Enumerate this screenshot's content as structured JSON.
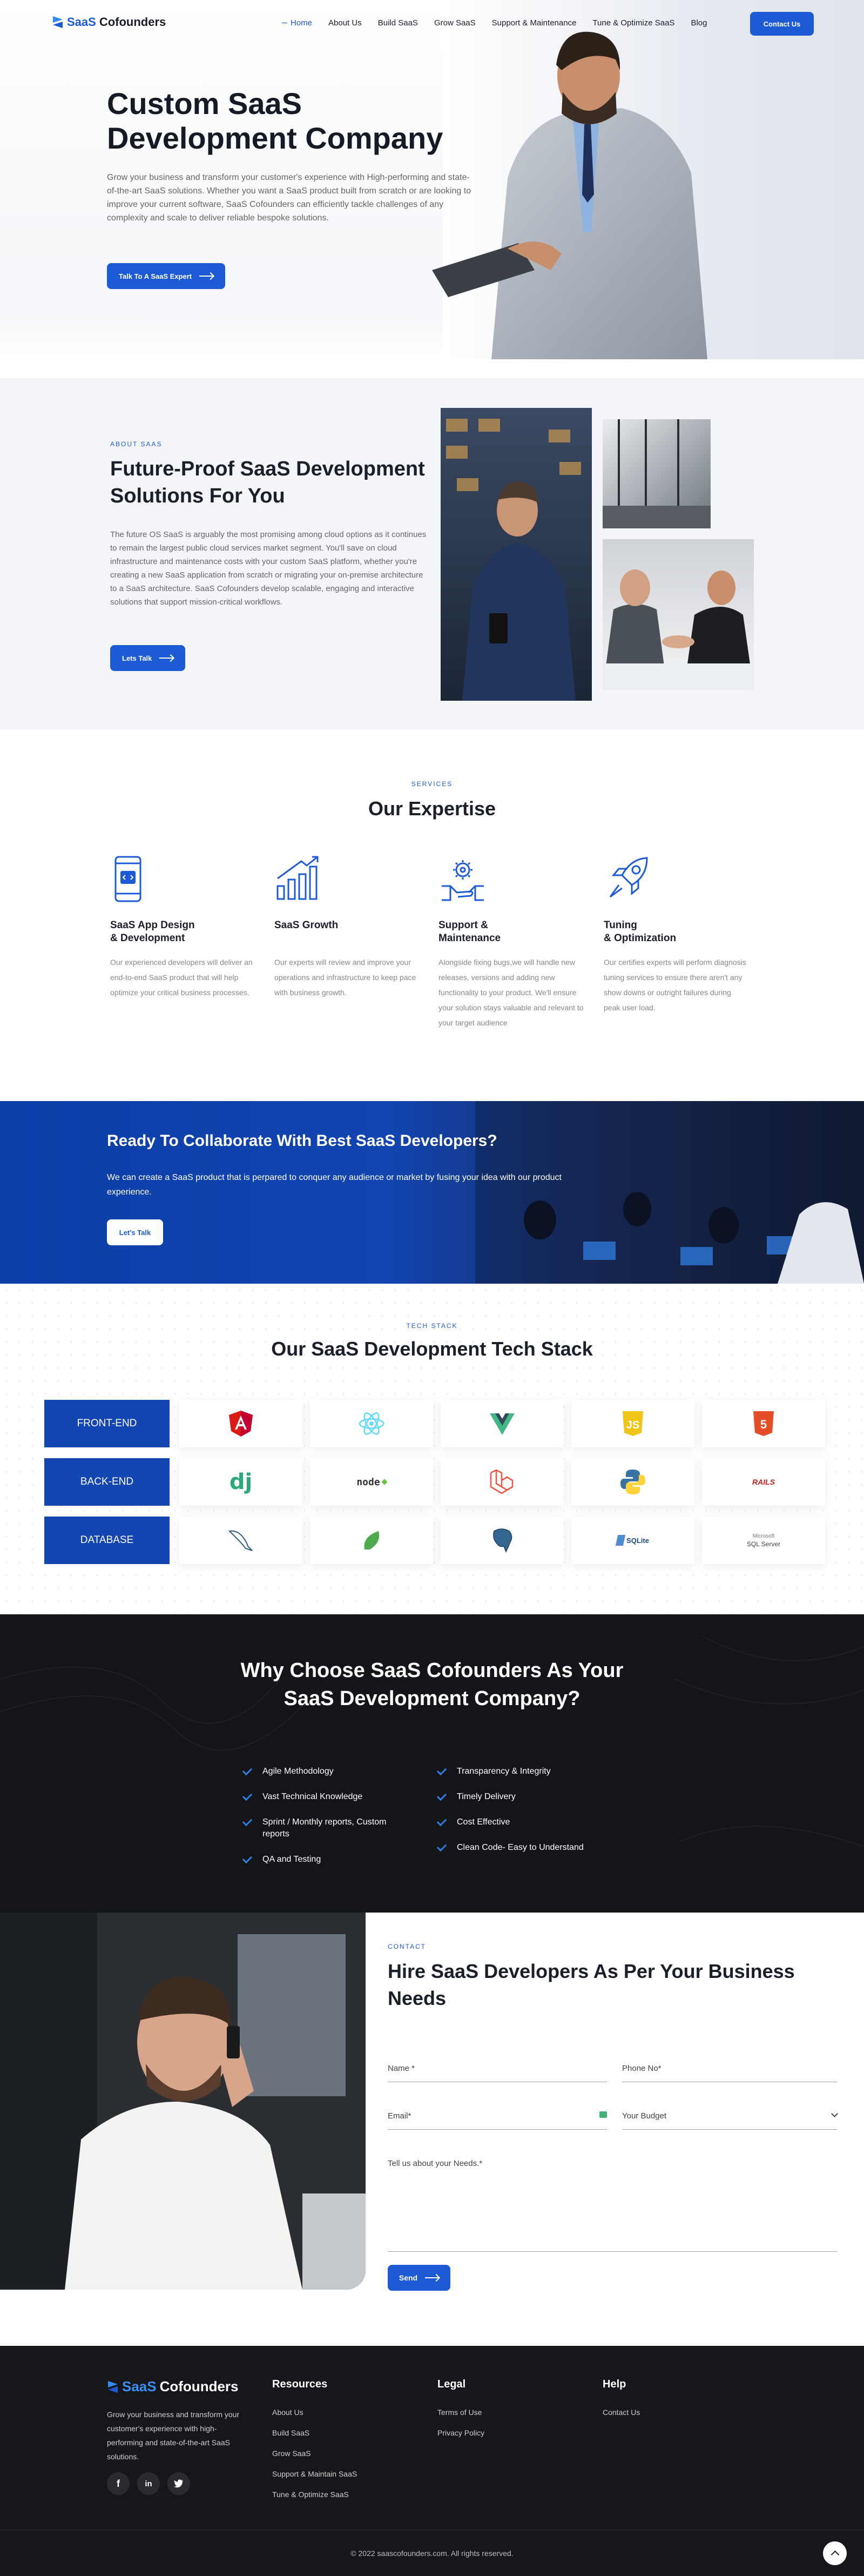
{
  "brand": {
    "logo_prefix": "SaaS",
    "logo_suffix": "Cofounders",
    "accent": "#1d5bd6",
    "dark": "#141518"
  },
  "nav": {
    "items": [
      "Home",
      "About Us",
      "Build SaaS",
      "Grow SaaS",
      "Support & Maintenance",
      "Tune & Optimize SaaS",
      "Blog"
    ],
    "cta": "Contact Us"
  },
  "hero": {
    "title": "Custom SaaS Development Company",
    "text": "Grow your business and transform your customer's experience with High-performing and state-of-the-art SaaS solutions. Whether you want a SaaS product built from scratch or are looking to improve your current software, SaaS Cofounders can efficiently tackle challenges of any complexity and scale to deliver reliable bespoke solutions.",
    "button": "Talk To A SaaS Expert"
  },
  "about": {
    "kicker": "About SaaS",
    "title": "Future-Proof SaaS Development Solutions For You",
    "text": "The future OS SaaS is arguably the most promising among cloud options as it continues to remain the largest public cloud services market segment. You'll save on cloud infrastructure and maintenance costs with your custom SaaS platform, whether you're creating a new SaaS application from scratch or migrating your on-premise architecture to a SaaS architecture. SaaS Cofounders develop scalable, engaging and interactive solutions that support mission-critical workflows.",
    "button": "Lets Talk"
  },
  "expertise": {
    "kicker": "Services",
    "title": "Our Expertise",
    "cards": [
      {
        "icon": "mobile-code-icon",
        "title_1": "SaaS App Design",
        "title_2": "& Development",
        "text": "Our experienced developers will deliver an end-to-end SaaS product that will help optimize your critical business processes."
      },
      {
        "icon": "growth-chart-icon",
        "title_1": "SaaS Growth",
        "title_2": "",
        "text": "Our experts will review and improve your operations and infrastructure to keep pace with business growth."
      },
      {
        "icon": "support-gear-icon",
        "title_1": "Support &",
        "title_2": "Maintenance",
        "text": "Alongside fixing bugs,we will handle new releases, versions and adding new functionality to your product. We'll ensure your solution stays valuable and relevant to your target audience"
      },
      {
        "icon": "rocket-icon",
        "title_1": "Tuning",
        "title_2": "& Optimization",
        "text": "Our certifies experts will perform diagnosis tuning services to ensure there aren't any show downs or outright failures during peak user load."
      }
    ]
  },
  "banner": {
    "title": "Ready To Collaborate With Best SaaS Developers?",
    "text": "We can create a SaaS product that is perpared to conquer any audience or market by fusing your idea with our product experience.",
    "button": "Let's Talk"
  },
  "tech": {
    "kicker": "Tech Stack",
    "title": "Our SaaS Development Tech Stack",
    "rows": [
      {
        "label": "FRONT-END",
        "logos": [
          "angular-logo",
          "react-logo",
          "vue-logo",
          "javascript-logo",
          "html5-logo"
        ]
      },
      {
        "label": "BACK-END",
        "logos": [
          "django-logo",
          "nodejs-logo",
          "laravel-logo",
          "python-logo",
          "rails-logo"
        ]
      },
      {
        "label": "DATABASE",
        "logos": [
          "mysql-logo",
          "mongodb-logo",
          "postgresql-logo",
          "sqlite-logo",
          "sqlserver-logo"
        ]
      }
    ],
    "logo_text": {
      "django": "dj",
      "node": "node",
      "rails": "RAILS",
      "sqlite": "SQLite",
      "sqlserver_1": "SQL Server",
      "sqlserver_2": "Microsoft"
    }
  },
  "why": {
    "title_1": "Why Choose SaaS Cofounders As Your",
    "title_2": "SaaS Development Company?",
    "left": [
      "Agile Methodology",
      "Vast Technical Knowledge",
      "Sprint / Monthly reports, Custom reports",
      "QA and Testing"
    ],
    "right": [
      "Transparency & Integrity",
      "Timely Delivery",
      "Cost Effective",
      "Clean Code- Easy to Understand"
    ]
  },
  "contact": {
    "kicker": "Contact",
    "title": "Hire SaaS Developers As Per Your Business Needs",
    "name_placeholder": "Name *",
    "phone_placeholder": "Phone No*",
    "email_placeholder": "Email*",
    "budget_placeholder": "Your Budget",
    "message_placeholder": "Tell us about your Needs.*",
    "button": "Send"
  },
  "footer": {
    "desc": "Grow your business and transform your customer's experience with high-performing and state-of-the-art SaaS solutions.",
    "social": [
      "f",
      "in",
      "t"
    ],
    "resources_title": "Resources",
    "resources": [
      "About Us",
      "Build SaaS",
      "Grow SaaS",
      "Support & Maintain SaaS",
      "Tune & Optimize SaaS"
    ],
    "legal_title": "Legal",
    "legal": [
      "Terms of Use",
      "Privacy Policy"
    ],
    "help_title": "Help",
    "help": [
      "Contact Us"
    ],
    "copyright": "© 2022 saascofounders.com. All rights reserved."
  }
}
